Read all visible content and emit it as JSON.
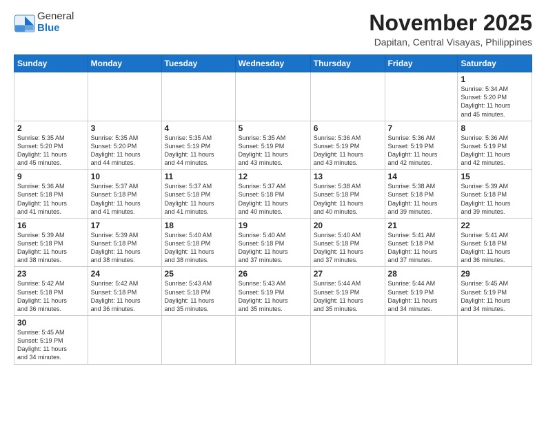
{
  "logo": {
    "text_general": "General",
    "text_blue": "Blue"
  },
  "title": "November 2025",
  "subtitle": "Dapitan, Central Visayas, Philippines",
  "weekdays": [
    "Sunday",
    "Monday",
    "Tuesday",
    "Wednesday",
    "Thursday",
    "Friday",
    "Saturday"
  ],
  "weeks": [
    [
      {
        "day": "",
        "info": ""
      },
      {
        "day": "",
        "info": ""
      },
      {
        "day": "",
        "info": ""
      },
      {
        "day": "",
        "info": ""
      },
      {
        "day": "",
        "info": ""
      },
      {
        "day": "",
        "info": ""
      },
      {
        "day": "1",
        "info": "Sunrise: 5:34 AM\nSunset: 5:20 PM\nDaylight: 11 hours\nand 45 minutes."
      }
    ],
    [
      {
        "day": "2",
        "info": "Sunrise: 5:35 AM\nSunset: 5:20 PM\nDaylight: 11 hours\nand 45 minutes."
      },
      {
        "day": "3",
        "info": "Sunrise: 5:35 AM\nSunset: 5:20 PM\nDaylight: 11 hours\nand 44 minutes."
      },
      {
        "day": "4",
        "info": "Sunrise: 5:35 AM\nSunset: 5:19 PM\nDaylight: 11 hours\nand 44 minutes."
      },
      {
        "day": "5",
        "info": "Sunrise: 5:35 AM\nSunset: 5:19 PM\nDaylight: 11 hours\nand 43 minutes."
      },
      {
        "day": "6",
        "info": "Sunrise: 5:36 AM\nSunset: 5:19 PM\nDaylight: 11 hours\nand 43 minutes."
      },
      {
        "day": "7",
        "info": "Sunrise: 5:36 AM\nSunset: 5:19 PM\nDaylight: 11 hours\nand 42 minutes."
      },
      {
        "day": "8",
        "info": "Sunrise: 5:36 AM\nSunset: 5:19 PM\nDaylight: 11 hours\nand 42 minutes."
      }
    ],
    [
      {
        "day": "9",
        "info": "Sunrise: 5:36 AM\nSunset: 5:18 PM\nDaylight: 11 hours\nand 41 minutes."
      },
      {
        "day": "10",
        "info": "Sunrise: 5:37 AM\nSunset: 5:18 PM\nDaylight: 11 hours\nand 41 minutes."
      },
      {
        "day": "11",
        "info": "Sunrise: 5:37 AM\nSunset: 5:18 PM\nDaylight: 11 hours\nand 41 minutes."
      },
      {
        "day": "12",
        "info": "Sunrise: 5:37 AM\nSunset: 5:18 PM\nDaylight: 11 hours\nand 40 minutes."
      },
      {
        "day": "13",
        "info": "Sunrise: 5:38 AM\nSunset: 5:18 PM\nDaylight: 11 hours\nand 40 minutes."
      },
      {
        "day": "14",
        "info": "Sunrise: 5:38 AM\nSunset: 5:18 PM\nDaylight: 11 hours\nand 39 minutes."
      },
      {
        "day": "15",
        "info": "Sunrise: 5:39 AM\nSunset: 5:18 PM\nDaylight: 11 hours\nand 39 minutes."
      }
    ],
    [
      {
        "day": "16",
        "info": "Sunrise: 5:39 AM\nSunset: 5:18 PM\nDaylight: 11 hours\nand 38 minutes."
      },
      {
        "day": "17",
        "info": "Sunrise: 5:39 AM\nSunset: 5:18 PM\nDaylight: 11 hours\nand 38 minutes."
      },
      {
        "day": "18",
        "info": "Sunrise: 5:40 AM\nSunset: 5:18 PM\nDaylight: 11 hours\nand 38 minutes."
      },
      {
        "day": "19",
        "info": "Sunrise: 5:40 AM\nSunset: 5:18 PM\nDaylight: 11 hours\nand 37 minutes."
      },
      {
        "day": "20",
        "info": "Sunrise: 5:40 AM\nSunset: 5:18 PM\nDaylight: 11 hours\nand 37 minutes."
      },
      {
        "day": "21",
        "info": "Sunrise: 5:41 AM\nSunset: 5:18 PM\nDaylight: 11 hours\nand 37 minutes."
      },
      {
        "day": "22",
        "info": "Sunrise: 5:41 AM\nSunset: 5:18 PM\nDaylight: 11 hours\nand 36 minutes."
      }
    ],
    [
      {
        "day": "23",
        "info": "Sunrise: 5:42 AM\nSunset: 5:18 PM\nDaylight: 11 hours\nand 36 minutes."
      },
      {
        "day": "24",
        "info": "Sunrise: 5:42 AM\nSunset: 5:18 PM\nDaylight: 11 hours\nand 36 minutes."
      },
      {
        "day": "25",
        "info": "Sunrise: 5:43 AM\nSunset: 5:18 PM\nDaylight: 11 hours\nand 35 minutes."
      },
      {
        "day": "26",
        "info": "Sunrise: 5:43 AM\nSunset: 5:19 PM\nDaylight: 11 hours\nand 35 minutes."
      },
      {
        "day": "27",
        "info": "Sunrise: 5:44 AM\nSunset: 5:19 PM\nDaylight: 11 hours\nand 35 minutes."
      },
      {
        "day": "28",
        "info": "Sunrise: 5:44 AM\nSunset: 5:19 PM\nDaylight: 11 hours\nand 34 minutes."
      },
      {
        "day": "29",
        "info": "Sunrise: 5:45 AM\nSunset: 5:19 PM\nDaylight: 11 hours\nand 34 minutes."
      }
    ],
    [
      {
        "day": "30",
        "info": "Sunrise: 5:45 AM\nSunset: 5:19 PM\nDaylight: 11 hours\nand 34 minutes."
      },
      {
        "day": "",
        "info": ""
      },
      {
        "day": "",
        "info": ""
      },
      {
        "day": "",
        "info": ""
      },
      {
        "day": "",
        "info": ""
      },
      {
        "day": "",
        "info": ""
      },
      {
        "day": "",
        "info": ""
      }
    ]
  ]
}
